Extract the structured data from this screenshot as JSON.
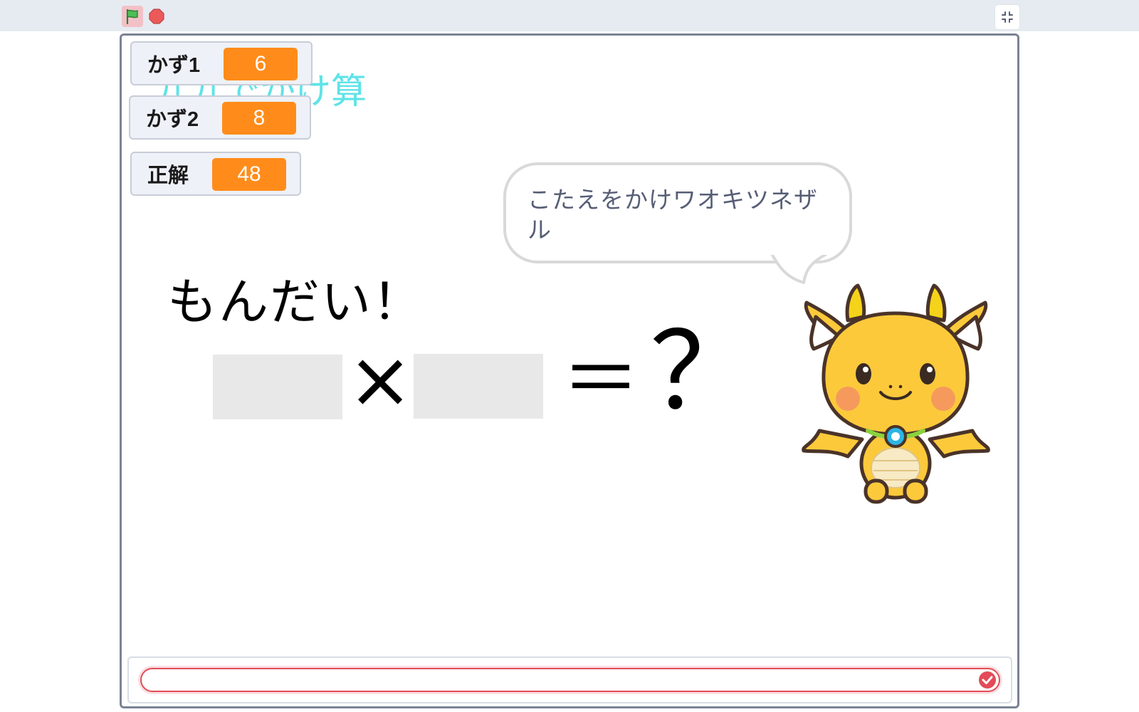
{
  "toolbar": {
    "green_flag_icon": "green-flag-icon",
    "stop_icon": "stop-icon",
    "fullscreen_icon": "exit-fullscreen-icon"
  },
  "stage": {
    "title": "九九でかけ算",
    "monitors": [
      {
        "label": "かず1",
        "value": "6"
      },
      {
        "label": "かず2",
        "value": "8"
      },
      {
        "label": "正解",
        "value": "48"
      }
    ],
    "speech_bubble": "こたえをかけワオキツネザル",
    "problem_heading": "もんだい！",
    "times_symbol": "×",
    "equals_symbol": "＝",
    "question_symbol": "？",
    "sprite": "dragon-character"
  },
  "answer": {
    "value": "",
    "submit_icon": "check-icon"
  },
  "colors": {
    "monitor_value_bg": "#ff8c1a",
    "title_color": "#5ee3e8",
    "stage_border": "#7b8394",
    "input_border": "#e24b57"
  }
}
